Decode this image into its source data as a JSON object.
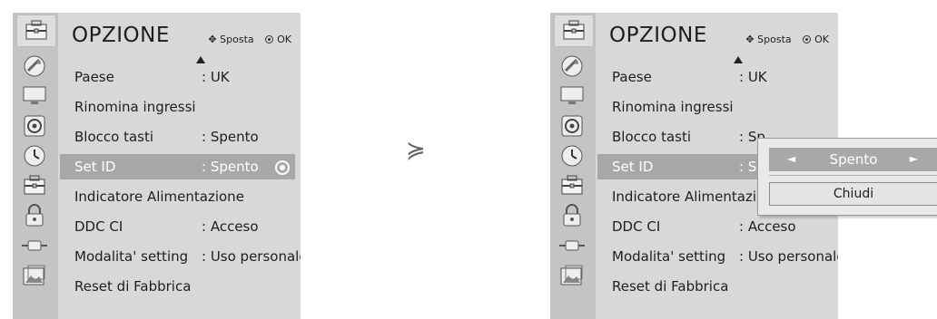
{
  "menu": {
    "title": "OPZIONE",
    "hint_move": "Sposta",
    "hint_ok": "OK",
    "move_glyph": "•◆",
    "items": [
      {
        "label": "Paese",
        "value": ": UK"
      },
      {
        "label": "Rinomina ingressi",
        "value": ""
      },
      {
        "label": "Blocco tasti",
        "value": ": Spento"
      },
      {
        "label": "Set ID",
        "value": ": Spento"
      },
      {
        "label": "Indicatore Alimentazione",
        "value": ""
      },
      {
        "label": "DDC CI",
        "value": ": Acceso"
      },
      {
        "label": "Modalita' setting",
        "value": ": Uso personale"
      },
      {
        "label": "Reset di Fabbrica",
        "value": ""
      }
    ],
    "right_items": [
      {
        "label": "Paese",
        "value": ": UK"
      },
      {
        "label": "Rinomina ingressi",
        "value": ""
      },
      {
        "label": "Blocco tasti",
        "value": ": Sp"
      },
      {
        "label": "Set ID",
        "value": ": Sp"
      },
      {
        "label": "Indicatore Alimentazione",
        "value": ""
      },
      {
        "label": "DDC CI",
        "value": ": Acceso"
      },
      {
        "label": "Modalita' setting",
        "value": ": Uso personale"
      },
      {
        "label": "Reset di Fabbrica",
        "value": ""
      }
    ],
    "sidebar_icons": [
      "satellite-icon",
      "monitor-icon",
      "speaker-icon",
      "clock-icon",
      "toolbox-icon",
      "lock-icon",
      "plug-icon",
      "photo-icon"
    ]
  },
  "separator": "≽",
  "popup": {
    "value": "Spento",
    "close_label": "Chiudi"
  },
  "colors": {
    "panel": "#d8d8d8",
    "sidebar": "#c4c4c4",
    "highlight": "#a8a8a8"
  }
}
